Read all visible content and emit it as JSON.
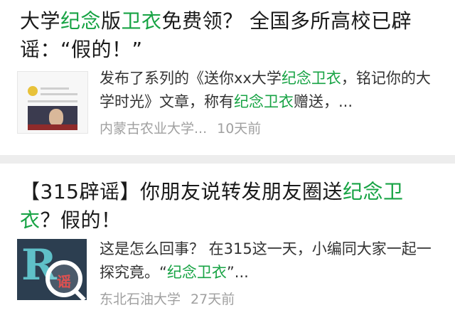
{
  "articles": [
    {
      "title_parts": [
        {
          "text": "大学",
          "highlight": false
        },
        {
          "text": "纪念",
          "highlight": true
        },
        {
          "text": "版",
          "highlight": false
        },
        {
          "text": "卫衣",
          "highlight": true
        },
        {
          "text": "免费领？ 全国多所高校已辟谣：“假的！”",
          "highlight": false
        }
      ],
      "snippet_parts": [
        {
          "text": "发布了系列的《送你xx大学",
          "highlight": false
        },
        {
          "text": "纪念卫衣",
          "highlight": true
        },
        {
          "text": "，铭记你的大学时光》文章，称有",
          "highlight": false
        },
        {
          "text": "纪念卫衣",
          "highlight": true
        },
        {
          "text": "赠送，...",
          "highlight": false
        }
      ],
      "source": "内蒙古农业大学...",
      "time": "10天前",
      "thumbnail_icon": "article-screenshot-thumbnail"
    },
    {
      "title_parts": [
        {
          "text": "【315辟谣】你朋友说转发朋友圈送",
          "highlight": false
        },
        {
          "text": "纪念卫衣",
          "highlight": true
        },
        {
          "text": "？假的！",
          "highlight": false
        }
      ],
      "snippet_parts": [
        {
          "text": "这是怎么回事？ 在315这一天，小编同大家一起一探究竟。“",
          "highlight": false
        },
        {
          "text": "纪念卫衣",
          "highlight": true
        },
        {
          "text": "”...",
          "highlight": false
        }
      ],
      "source": "东北石油大学",
      "time": "27天前",
      "thumbnail_icon": "rumor-magnifier-thumbnail",
      "thumbnail_text": "谣"
    }
  ],
  "colors": {
    "highlight": "#17a344",
    "meta": "#a0a0a0",
    "background": "#ededed"
  }
}
